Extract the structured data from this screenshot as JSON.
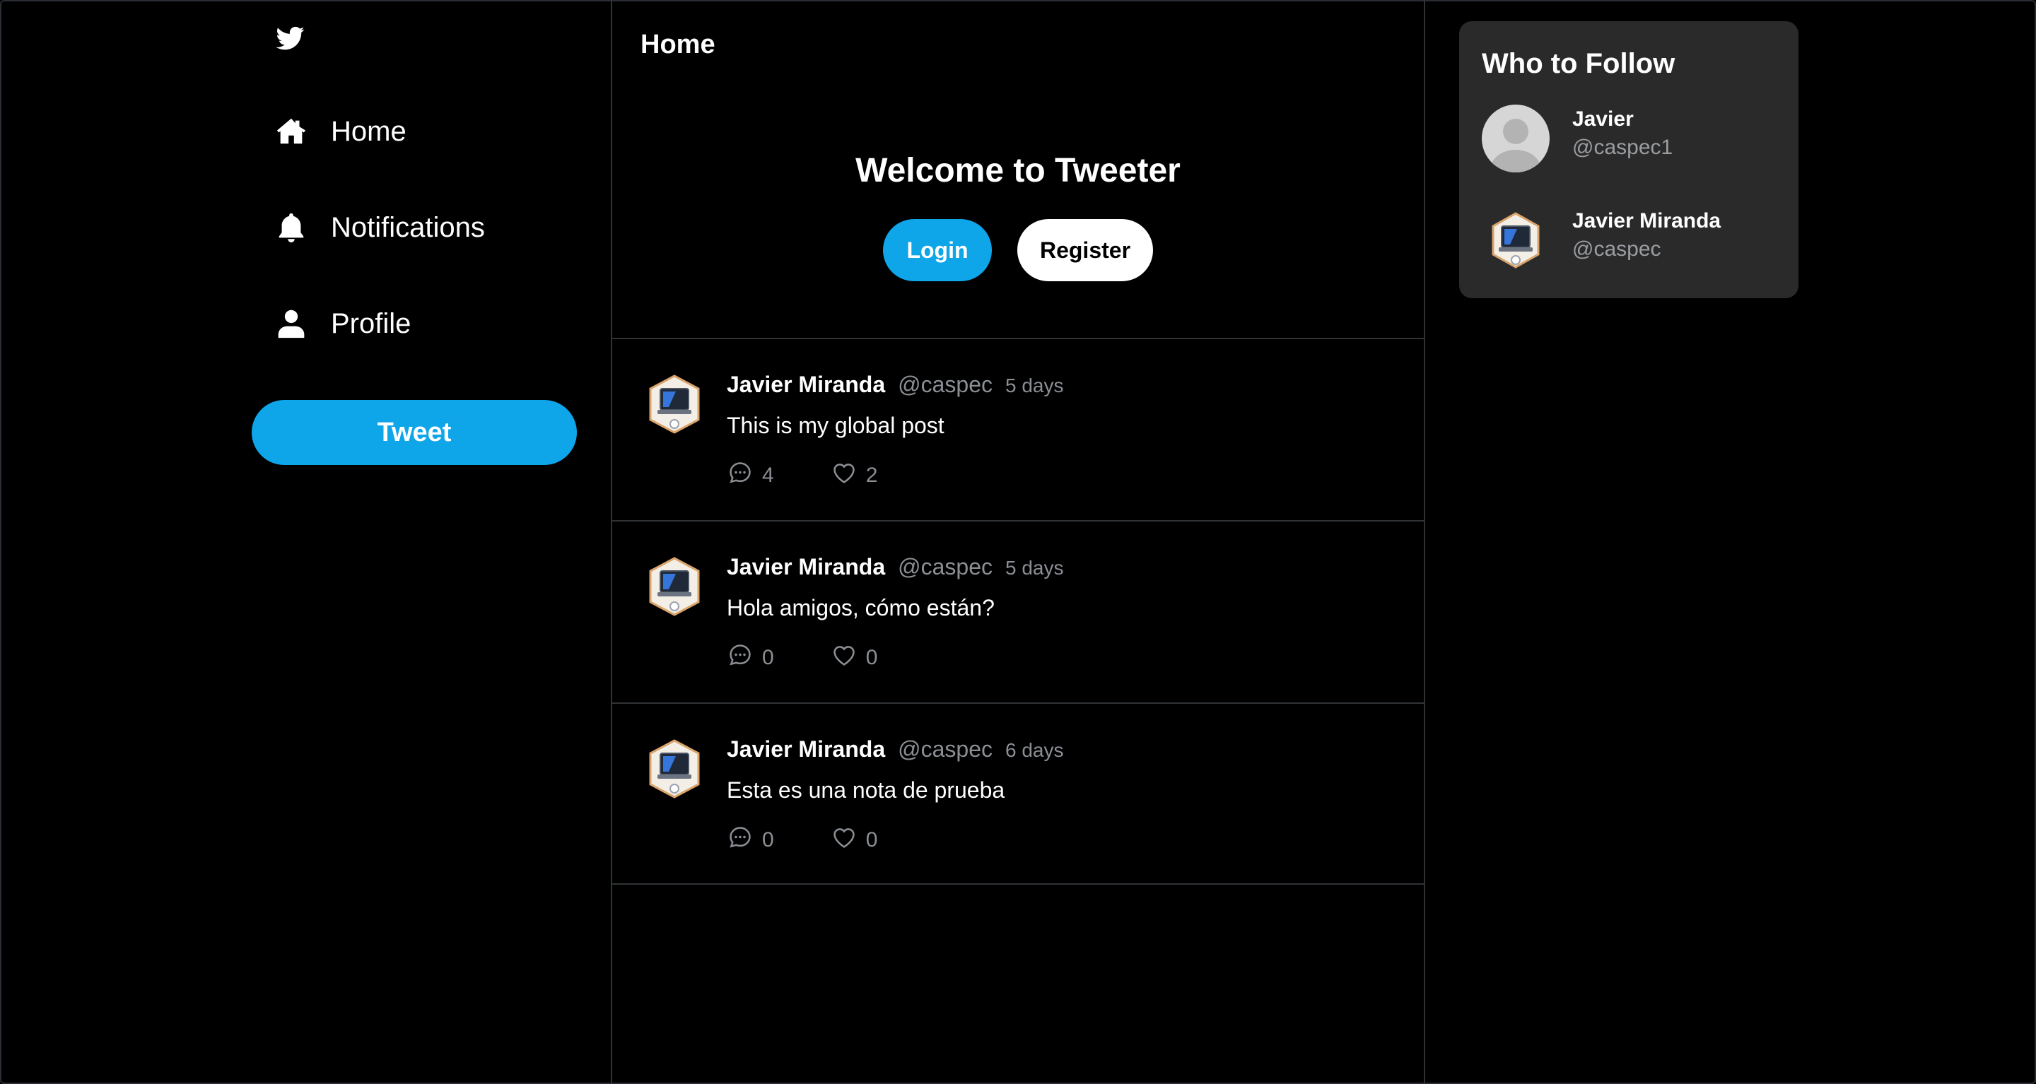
{
  "sidebar": {
    "logo_icon": "twitter-bird-icon",
    "items": [
      {
        "label": "Home",
        "icon": "home-icon"
      },
      {
        "label": "Notifications",
        "icon": "bell-icon"
      },
      {
        "label": "Profile",
        "icon": "user-icon"
      }
    ],
    "tweet_button": "Tweet"
  },
  "main": {
    "title": "Home",
    "welcome": "Welcome to Tweeter",
    "login_label": "Login",
    "register_label": "Register",
    "tweets": [
      {
        "name": "Javier Miranda",
        "handle": "@caspec",
        "time": "5 days",
        "text": "This is my global post",
        "comments": "4",
        "likes": "2"
      },
      {
        "name": "Javier Miranda",
        "handle": "@caspec",
        "time": "5 days",
        "text": "Hola amigos, cómo están?",
        "comments": "0",
        "likes": "0"
      },
      {
        "name": "Javier Miranda",
        "handle": "@caspec",
        "time": "6 days",
        "text": "Esta es una nota de prueba",
        "comments": "0",
        "likes": "0"
      }
    ]
  },
  "who_to_follow": {
    "title": "Who to Follow",
    "users": [
      {
        "name": "Javier",
        "handle": "@caspec1",
        "avatar": "default-avatar"
      },
      {
        "name": "Javier Miranda",
        "handle": "@caspec",
        "avatar": "laptop-badge-avatar"
      }
    ]
  },
  "colors": {
    "accent": "#0ea5e9",
    "background": "#000000",
    "card": "#2a2a2a",
    "border": "#2f3336",
    "muted": "#8b8f94"
  }
}
